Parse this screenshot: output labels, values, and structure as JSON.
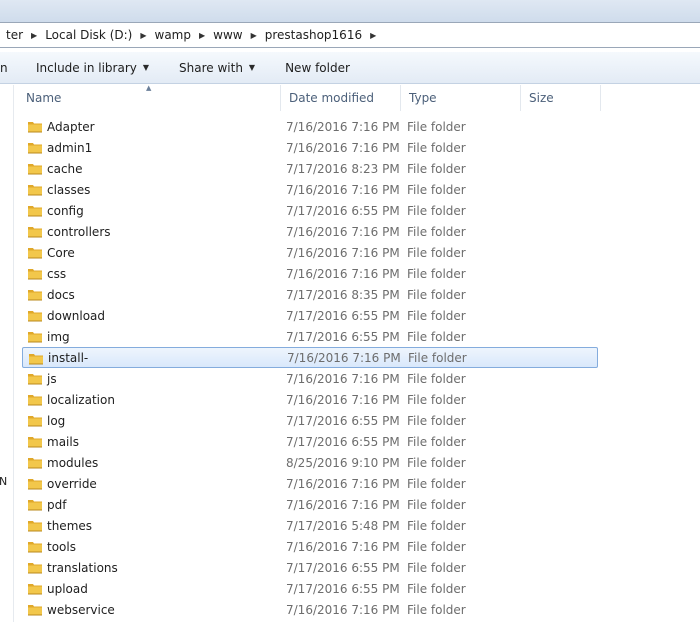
{
  "breadcrumb": {
    "items": [
      "ter",
      "Local Disk (D:)",
      "wamp",
      "www",
      "prestashop1616"
    ]
  },
  "toolbar": {
    "partial_left": "n",
    "include_in_library": "Include in library",
    "share_with": "Share with",
    "new_folder": "New folder"
  },
  "left_pane": {
    "stub_text": "N"
  },
  "columns": {
    "name": "Name",
    "date_modified": "Date modified",
    "type": "Type",
    "size": "Size"
  },
  "colors": {
    "folder_body": "#f2c74b",
    "folder_tab": "#e0a82a",
    "selection_border": "#84acdd"
  },
  "files": [
    {
      "name": "Adapter",
      "date": "7/16/2016 7:16 PM",
      "type": "File folder",
      "icon": "folder-icon"
    },
    {
      "name": "admin1",
      "date": "7/16/2016 7:16 PM",
      "type": "File folder",
      "icon": "folder-icon"
    },
    {
      "name": "cache",
      "date": "7/17/2016 8:23 PM",
      "type": "File folder",
      "icon": "folder-icon"
    },
    {
      "name": "classes",
      "date": "7/16/2016 7:16 PM",
      "type": "File folder",
      "icon": "folder-icon"
    },
    {
      "name": "config",
      "date": "7/17/2016 6:55 PM",
      "type": "File folder",
      "icon": "folder-icon"
    },
    {
      "name": "controllers",
      "date": "7/16/2016 7:16 PM",
      "type": "File folder",
      "icon": "folder-icon"
    },
    {
      "name": "Core",
      "date": "7/16/2016 7:16 PM",
      "type": "File folder",
      "icon": "folder-icon"
    },
    {
      "name": "css",
      "date": "7/16/2016 7:16 PM",
      "type": "File folder",
      "icon": "folder-icon"
    },
    {
      "name": "docs",
      "date": "7/17/2016 8:35 PM",
      "type": "File folder",
      "icon": "folder-icon"
    },
    {
      "name": "download",
      "date": "7/17/2016 6:55 PM",
      "type": "File folder",
      "icon": "folder-icon"
    },
    {
      "name": "img",
      "date": "7/17/2016 6:55 PM",
      "type": "File folder",
      "icon": "folder-icon"
    },
    {
      "name": "install-",
      "date": "7/16/2016 7:16 PM",
      "type": "File folder",
      "icon": "folder-icon",
      "selected": true
    },
    {
      "name": "js",
      "date": "7/16/2016 7:16 PM",
      "type": "File folder",
      "icon": "folder-icon"
    },
    {
      "name": "localization",
      "date": "7/16/2016 7:16 PM",
      "type": "File folder",
      "icon": "folder-icon"
    },
    {
      "name": "log",
      "date": "7/17/2016 6:55 PM",
      "type": "File folder",
      "icon": "folder-icon"
    },
    {
      "name": "mails",
      "date": "7/17/2016 6:55 PM",
      "type": "File folder",
      "icon": "folder-icon"
    },
    {
      "name": "modules",
      "date": "8/25/2016 9:10 PM",
      "type": "File folder",
      "icon": "folder-icon"
    },
    {
      "name": "override",
      "date": "7/16/2016 7:16 PM",
      "type": "File folder",
      "icon": "folder-icon"
    },
    {
      "name": "pdf",
      "date": "7/16/2016 7:16 PM",
      "type": "File folder",
      "icon": "folder-icon"
    },
    {
      "name": "themes",
      "date": "7/17/2016 5:48 PM",
      "type": "File folder",
      "icon": "folder-icon"
    },
    {
      "name": "tools",
      "date": "7/16/2016 7:16 PM",
      "type": "File folder",
      "icon": "folder-icon"
    },
    {
      "name": "translations",
      "date": "7/17/2016 6:55 PM",
      "type": "File folder",
      "icon": "folder-icon"
    },
    {
      "name": "upload",
      "date": "7/17/2016 6:55 PM",
      "type": "File folder",
      "icon": "folder-icon"
    },
    {
      "name": "webservice",
      "date": "7/16/2016 7:16 PM",
      "type": "File folder",
      "icon": "folder-icon"
    }
  ]
}
